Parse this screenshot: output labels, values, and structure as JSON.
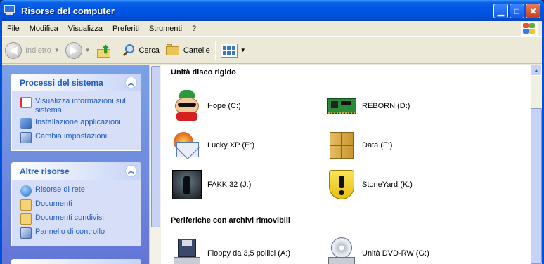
{
  "window": {
    "title": "Risorse del computer"
  },
  "menu": [
    {
      "ul": "F",
      "rest": "ile"
    },
    {
      "ul": "M",
      "rest": "odifica"
    },
    {
      "ul": "V",
      "rest": "isualizza"
    },
    {
      "ul": "P",
      "rest": "referiti"
    },
    {
      "ul": "S",
      "rest": "trumenti"
    },
    {
      "ul": "?",
      "rest": ""
    }
  ],
  "toolbar": {
    "back": "Indietro",
    "search": "Cerca",
    "folders": "Cartelle"
  },
  "tasks_panel": {
    "title": "Processi del sistema",
    "items": [
      "Visualizza informazioni sul sistema",
      "Installazione applicazioni",
      "Cambia impostazioni"
    ]
  },
  "other_panel": {
    "title": "Altre risorse",
    "items": [
      "Risorse di rete",
      "Documenti",
      "Documenti condivisi",
      "Pannello di controllo"
    ]
  },
  "sections": {
    "hard_disks": "Unità disco rigido",
    "removable": "Periferiche con archivi rimovibili"
  },
  "drives": [
    {
      "label": "Hope (C:)",
      "icon": "cartoon-character-icon"
    },
    {
      "label": "REBORN (D:)",
      "icon": "circuit-board-icon"
    },
    {
      "label": "Lucky XP (E:)",
      "icon": "email-envelope-icon"
    },
    {
      "label": "Data (F:)",
      "icon": "box-icon"
    },
    {
      "label": "FAKK 32 (J:)",
      "icon": "dark-figure-icon"
    },
    {
      "label": "StoneYard (K:)",
      "icon": "warning-shield-icon"
    }
  ],
  "removable": [
    {
      "label": "Floppy da 3,5 pollici (A:)",
      "icon": "floppy-drive-icon"
    },
    {
      "label": "Unità DVD-RW (G:)",
      "icon": "dvd-drive-icon"
    }
  ]
}
